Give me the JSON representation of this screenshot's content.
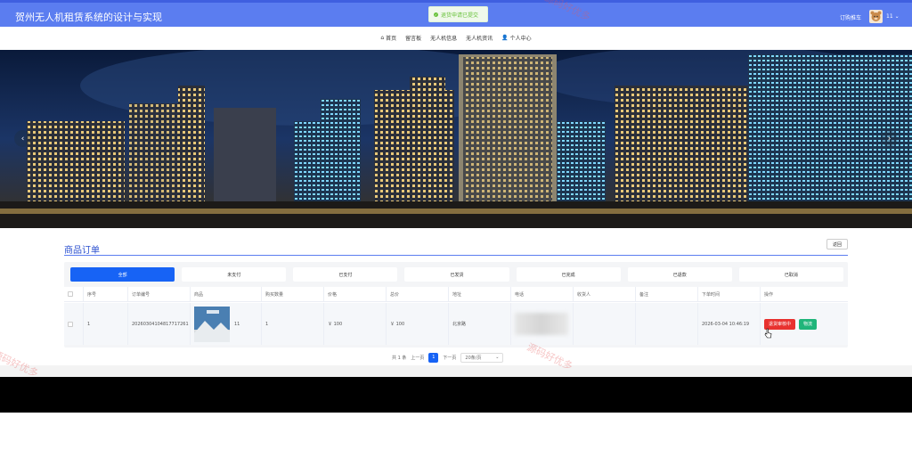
{
  "header": {
    "site_title": "贺州无人机租赁系统的设计与实现",
    "toast_message": "退货申请已提交",
    "cart_label": "订购推车",
    "user_name": "11"
  },
  "nav": {
    "items": [
      {
        "label": "首页",
        "icon": "home-icon"
      },
      {
        "label": "留言板"
      },
      {
        "label": "无人机信息"
      },
      {
        "label": "无人机资讯"
      },
      {
        "label": "个人中心",
        "icon": "user-icon"
      }
    ]
  },
  "section": {
    "title": "商品订单",
    "back_label": "返回"
  },
  "tabs": [
    "全部",
    "未支付",
    "已支付",
    "已发货",
    "已完成",
    "已退款",
    "已取消"
  ],
  "table": {
    "headers": [
      "序号",
      "订单编号",
      "商品",
      "购买数量",
      "价格",
      "总价",
      "地址",
      "电话",
      "收货人",
      "备注",
      "下单时间",
      "操作"
    ],
    "rows": [
      {
        "index": "1",
        "order_no": "20260304104817717261",
        "product_name": "11",
        "quantity": "1",
        "price": "￥ 100",
        "total": "￥ 100",
        "address": "北京路",
        "phone": "",
        "receiver": "",
        "note": "",
        "time": "2026-03-04 10:46:19",
        "action_primary": "退货审核中",
        "action_secondary": "物流"
      }
    ]
  },
  "pager": {
    "total": "共 1 条",
    "prev": "上一页",
    "page": "1",
    "next": "下一页",
    "size": "20条/页"
  },
  "watermark": "源码好优多",
  "colors": {
    "header_bg": "#5b7df0",
    "accent": "#1763f5",
    "danger": "#e8322f",
    "success": "#1fb57a"
  }
}
